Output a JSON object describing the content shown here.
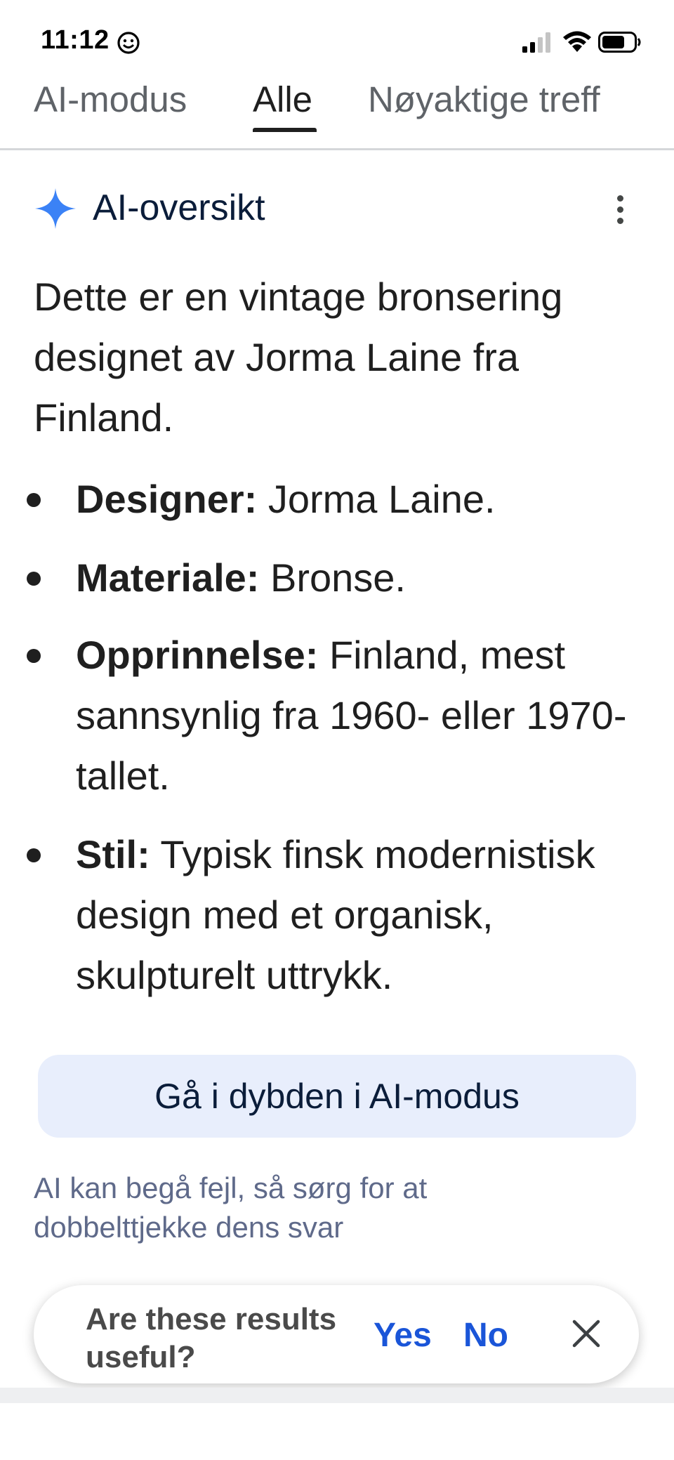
{
  "status_bar": {
    "time": "11:12",
    "icons": [
      "smiley-icon",
      "cellular-signal-icon",
      "wifi-icon",
      "battery-icon"
    ]
  },
  "tabs": [
    {
      "label": "AI-modus",
      "active": false
    },
    {
      "label": "Alle",
      "active": true
    },
    {
      "label": "Nøyaktige treff",
      "active": false
    }
  ],
  "ai_overview": {
    "title": "AI-oversikt",
    "intro": "Dette er en vintage bronsering designet av Jorma Laine fra Finland.",
    "bullets": [
      {
        "term": "Designer:",
        "text": " Jorma Laine."
      },
      {
        "term": "Materiale:",
        "text": " Bronse."
      },
      {
        "term": "Opprinnelse:",
        "text": " Finland, mest sannsynlig fra 1960- eller 1970-tallet."
      },
      {
        "term": "Stil:",
        "text": " Typisk finsk modernistisk design med et organisk, skulpturelt uttrykk."
      }
    ],
    "deep_dive_button": "Gå i dybden i AI-modus",
    "disclaimer": "AI kan begå fejl, så sørg for at dobbelttjekke dens svar"
  },
  "feedback": {
    "question": "Are these results useful?",
    "yes_label": "Yes",
    "no_label": "No"
  },
  "colors": {
    "accent_blue": "#1a55d8",
    "spark_blue": "#3b82f6",
    "button_bg": "#e8eefc",
    "disclaimer_text": "#5f6a8a"
  }
}
